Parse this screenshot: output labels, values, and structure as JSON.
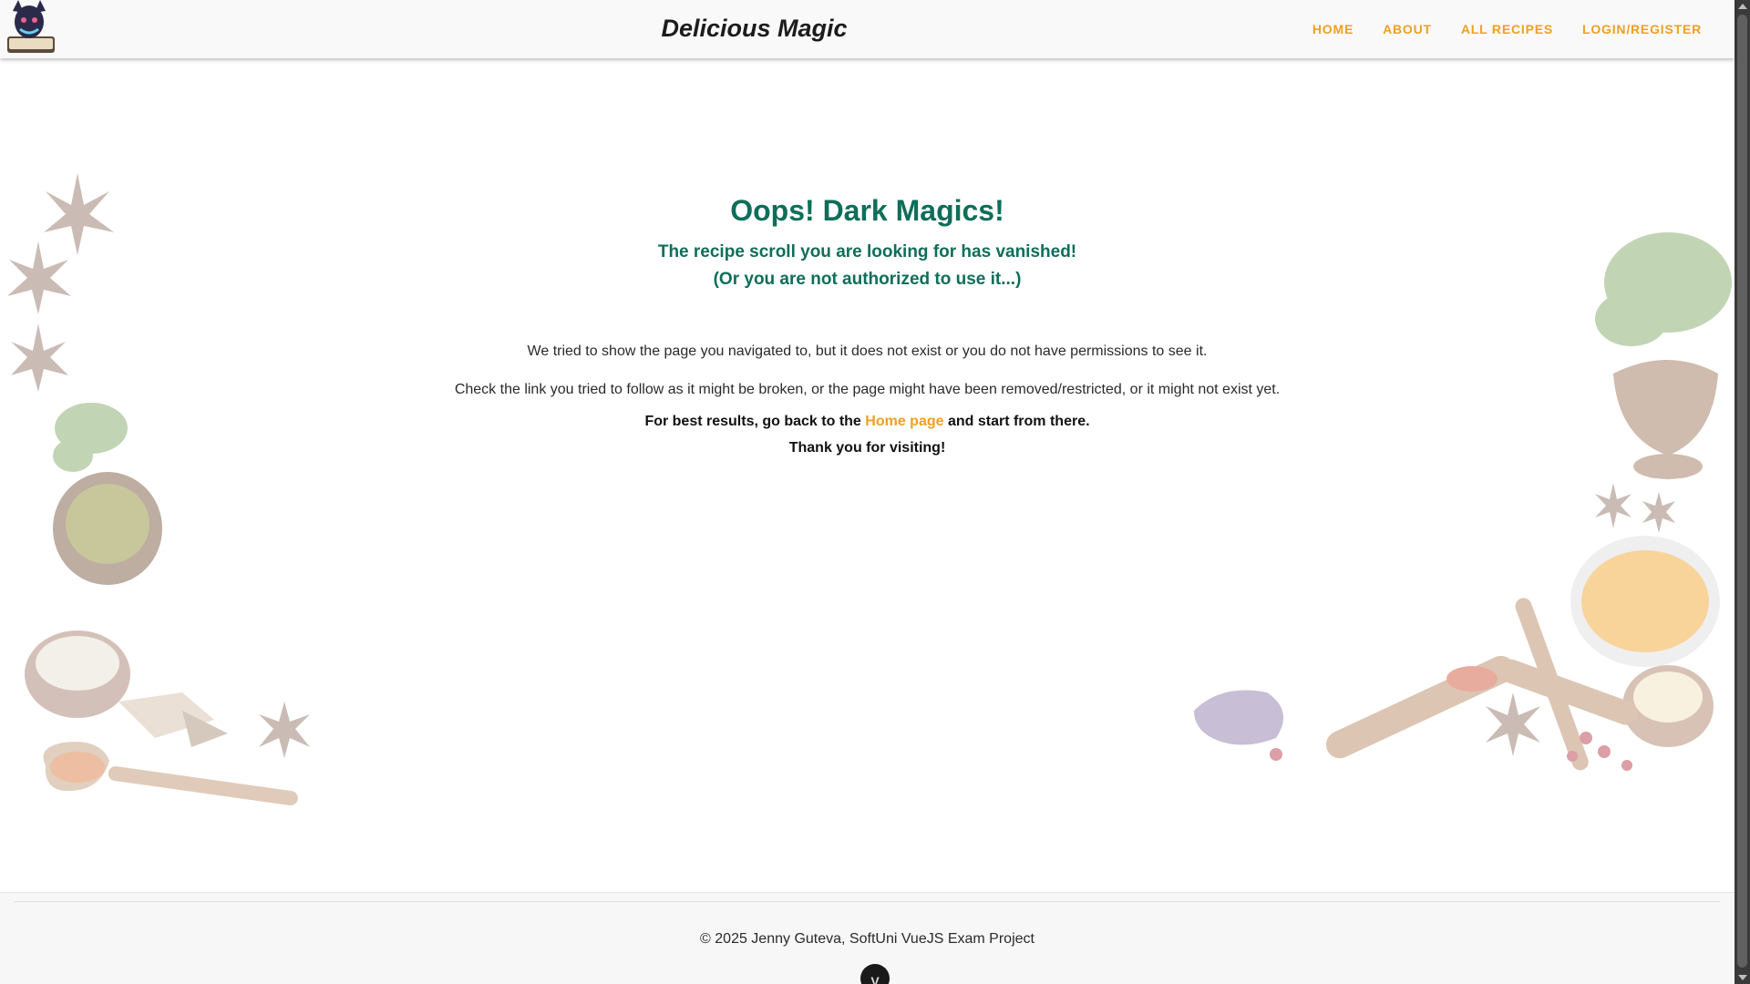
{
  "header": {
    "brand": "Delicious Magic",
    "nav": [
      {
        "label": "HOME"
      },
      {
        "label": "ABOUT"
      },
      {
        "label": "ALL RECIPES"
      },
      {
        "label": "LOGIN/REGISTER"
      }
    ]
  },
  "main": {
    "title": "Oops! Dark Magics!",
    "subtitle_line1": "The recipe scroll you are looking for has vanished!",
    "subtitle_line2": "(Or you are not authorized to use it...)",
    "paragraph1": "We tried to show the page you navigated to, but it does not exist or you do not have permissions to see it.",
    "paragraph2": "Check the link you tried to follow as it might be broken, or the page might have been removed/restricted, or it might not exist yet.",
    "paragraph3_before": "For best results, go back to the ",
    "paragraph3_link": "Home page",
    "paragraph3_after": " and start from there.",
    "paragraph4": "Thank you for visiting!"
  },
  "footer": {
    "copyright": "© 2025 Jenny Guteva, SoftUni VueJS Exam Project",
    "badge": "V"
  },
  "colors": {
    "accent": "#f0a020",
    "heading": "#0e6e5a"
  }
}
